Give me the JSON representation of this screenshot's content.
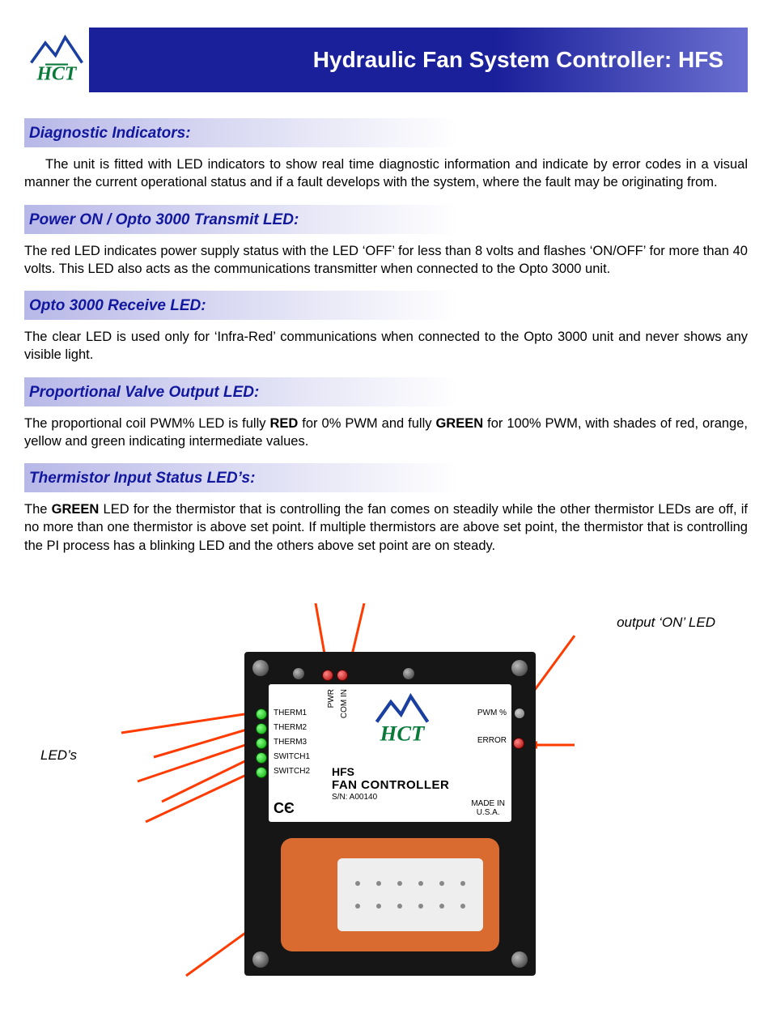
{
  "header": {
    "title": "Hydraulic Fan System Controller: HFS",
    "logo_text": "HCT"
  },
  "sections": [
    {
      "heading": "Diagnostic Indicators:",
      "body": "The unit is fitted with LED indicators to show real time diagnostic information and indicate by error codes in a visual manner the current operational status and if a fault develops with the system,  where the fault may be originating from.",
      "indent": true
    },
    {
      "heading": "Power ON / Opto 3000 Transmit LED:",
      "body": "The red LED indicates power supply status with the LED ‘OFF’ for less than 8 volts and flashes ‘ON/OFF’ for more than 40 volts. This LED also acts as the communications transmitter when connected to the Opto 3000 unit."
    },
    {
      "heading": "Opto 3000 Receive LED:",
      "body": "The clear LED is used only for ‘Infra-Red’ communications when connected to the Opto 3000 unit and never shows any visible light."
    },
    {
      "heading": "Proportional Valve Output LED:",
      "body_html": "The proportional coil PWM% LED is fully <b>RED</b> for 0% PWM and fully <b>GREEN</b> for 100% PWM, with shades of red, orange, yellow and green indicating intermediate values."
    },
    {
      "heading": "Thermistor Input Status LED’s:",
      "body_html": "The <b>GREEN</b> LED for the thermistor that is controlling the fan comes on steadily while the other thermistor LEDs are off, if no more than one thermistor is above set point.  If multiple thermistors are above set point, the thermistor that is controlling the PI process has a blinking LED and the others above set point are on steady."
    }
  ],
  "figure": {
    "callout_left": "LED’s",
    "callout_right": "output ‘ON’ LED",
    "label_rows": [
      "THERM1",
      "THERM2",
      "THERM3",
      "SWITCH1",
      "SWITCH2"
    ],
    "vert_labels": [
      "PWR",
      "COM IN"
    ],
    "right_labels": [
      "PWM %",
      "ERROR"
    ],
    "product_line1": "HFS",
    "product_line2": "FAN CONTROLLER",
    "sn": "S/N: A00140",
    "made_in": "MADE IN\nU.S.A.",
    "ce": "CЄ"
  }
}
